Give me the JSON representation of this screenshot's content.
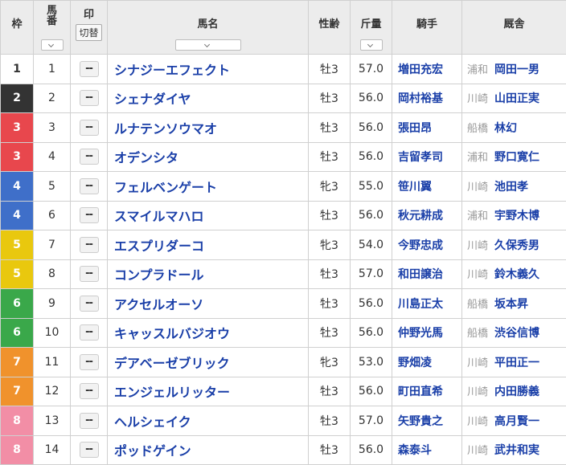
{
  "headers": {
    "waku": "枠",
    "umaban_top": "馬",
    "umaban_bottom": "番",
    "mark": "印",
    "kirikae": "切替",
    "name": "馬名",
    "sexage": "性齢",
    "weight": "斤量",
    "jockey": "騎手",
    "stable": "厩舎"
  },
  "mark_placeholder": "--",
  "waku_colors": {
    "1": {
      "bg": "#ffffff",
      "fg": "#333333"
    },
    "2": {
      "bg": "#333333",
      "fg": "#ffffff"
    },
    "3": {
      "bg": "#e8474d",
      "fg": "#ffffff"
    },
    "4": {
      "bg": "#3f6fc9",
      "fg": "#ffffff"
    },
    "5": {
      "bg": "#e9c80e",
      "fg": "#ffffff"
    },
    "6": {
      "bg": "#3aa84a",
      "fg": "#ffffff"
    },
    "7": {
      "bg": "#f0922c",
      "fg": "#ffffff"
    },
    "8": {
      "bg": "#f28ea6",
      "fg": "#ffffff"
    }
  },
  "rows": [
    {
      "waku": "1",
      "num": "1",
      "name": "シナジーエフェクト",
      "sexage": "牡3",
      "weight": "57.0",
      "jockey": "増田充宏",
      "region": "浦和",
      "trainer": "岡田一男"
    },
    {
      "waku": "2",
      "num": "2",
      "name": "シェナダイヤ",
      "sexage": "牡3",
      "weight": "56.0",
      "jockey": "岡村裕基",
      "region": "川崎",
      "trainer": "山田正実"
    },
    {
      "waku": "3",
      "num": "3",
      "name": "ルナテンソウマオ",
      "sexage": "牡3",
      "weight": "56.0",
      "jockey": "張田昂",
      "region": "船橋",
      "trainer": "林幻"
    },
    {
      "waku": "3",
      "num": "4",
      "name": "オデンシタ",
      "sexage": "牡3",
      "weight": "56.0",
      "jockey": "吉留孝司",
      "region": "浦和",
      "trainer": "野口寛仁"
    },
    {
      "waku": "4",
      "num": "5",
      "name": "フェルベンゲート",
      "sexage": "牝3",
      "weight": "55.0",
      "jockey": "笹川翼",
      "region": "川崎",
      "trainer": "池田孝"
    },
    {
      "waku": "4",
      "num": "6",
      "name": "スマイルマハロ",
      "sexage": "牡3",
      "weight": "56.0",
      "jockey": "秋元耕成",
      "region": "浦和",
      "trainer": "宇野木博"
    },
    {
      "waku": "5",
      "num": "7",
      "name": "エスプリダーコ",
      "sexage": "牝3",
      "weight": "54.0",
      "jockey": "今野忠成",
      "region": "川崎",
      "trainer": "久保秀男"
    },
    {
      "waku": "5",
      "num": "8",
      "name": "コンプラドール",
      "sexage": "牡3",
      "weight": "57.0",
      "jockey": "和田譲治",
      "region": "川崎",
      "trainer": "鈴木義久"
    },
    {
      "waku": "6",
      "num": "9",
      "name": "アクセルオーソ",
      "sexage": "牡3",
      "weight": "56.0",
      "jockey": "川島正太",
      "region": "船橋",
      "trainer": "坂本昇"
    },
    {
      "waku": "6",
      "num": "10",
      "name": "キャッスルバジオウ",
      "sexage": "牡3",
      "weight": "56.0",
      "jockey": "仲野光馬",
      "region": "船橋",
      "trainer": "渋谷信博"
    },
    {
      "waku": "7",
      "num": "11",
      "name": "デアベーゼブリック",
      "sexage": "牝3",
      "weight": "53.0",
      "jockey": "野畑凌",
      "region": "川崎",
      "trainer": "平田正一"
    },
    {
      "waku": "7",
      "num": "12",
      "name": "エンジェルリッター",
      "sexage": "牡3",
      "weight": "56.0",
      "jockey": "町田直希",
      "region": "川崎",
      "trainer": "内田勝義"
    },
    {
      "waku": "8",
      "num": "13",
      "name": "ヘルシェイク",
      "sexage": "牡3",
      "weight": "57.0",
      "jockey": "矢野貴之",
      "region": "川崎",
      "trainer": "高月賢一"
    },
    {
      "waku": "8",
      "num": "14",
      "name": "ポッドゲイン",
      "sexage": "牡3",
      "weight": "56.0",
      "jockey": "森泰斗",
      "region": "川崎",
      "trainer": "武井和実"
    }
  ]
}
